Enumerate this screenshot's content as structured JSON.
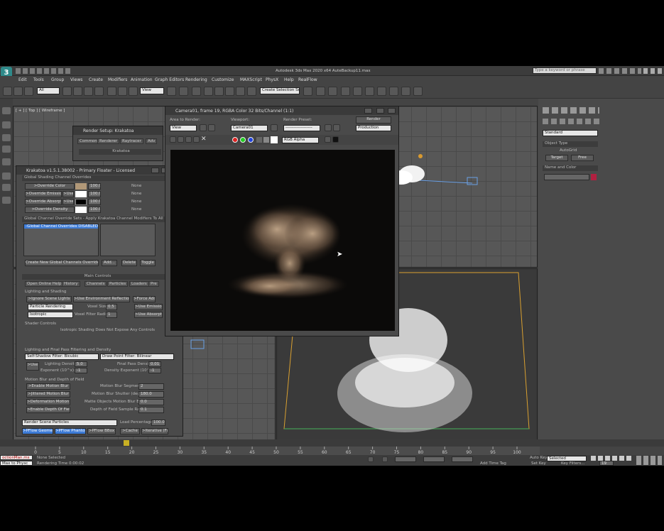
{
  "app": {
    "title": "Autodesk 3ds Max 2020 x64    AuteBackup11.max",
    "search_placeholder": "Type a keyword or phrase",
    "menu": [
      "Edit",
      "Tools",
      "Group",
      "Views",
      "Create",
      "Modifiers",
      "Animation",
      "Graph Editors",
      "Rendering",
      "Customize",
      "MAXScript",
      "PhysX",
      "Help",
      "RealFlow"
    ],
    "selection_filter": "All",
    "view_dropdown": "View",
    "create_selection": "Create Selection Se"
  },
  "viewport_top": {
    "label": "[ + ] [ Top ] [ Wireframe ]"
  },
  "render_setup": {
    "title": "Render Setup: Krakatoa",
    "tabs": [
      "Common",
      "Renderer",
      "Raytracer",
      "Adv"
    ],
    "section": "Krakatoa"
  },
  "frame_window": {
    "title": "Camera01, frame 19, RGBA Color 32 Bits/Channel (1:1)",
    "area_label": "Area to Render:",
    "area_value": "View",
    "viewport_label": "Viewport:",
    "viewport_value": "Camera01",
    "preset_label": "Render Preset:",
    "preset_value": "-------------------",
    "render_button": "Render",
    "production_value": "Production",
    "channel_value": "RGB Alpha"
  },
  "krakatoa": {
    "title": "Krakatoa v1.5.1.38002 - Primary Floater - Licensed",
    "overrides_header": "Global Shading Channel Overrides",
    "override_rows": [
      {
        "button": ">Override Color",
        "value": "100.0",
        "status": "None"
      },
      {
        "button": ">Override Emission",
        "use": ">Use",
        "value": "100.0",
        "status": "None"
      },
      {
        "button": ">Override Absorption",
        "use": ">Use",
        "value": "100.0",
        "status": "None"
      },
      {
        "button": ">Override Density",
        "value": "100.0",
        "status": "None"
      }
    ],
    "override_sets_header": "Global Channel Override Sets - Apply Krakatoa Channel Modifiers To All Particl",
    "override_list_item": "-Global Channel Overrides DISABLED-",
    "set_buttons": [
      "Create New Global Channels Override Set",
      "Add...",
      "Delete",
      "Toggle"
    ],
    "main_controls": "Main Controls",
    "main_tabs": [
      "Open Online Help...",
      "History",
      "Channels",
      "Particles",
      "Loaders",
      "Pre"
    ],
    "lighting_header": "Lighting and Shading",
    "lighting_buttons": [
      ">Ignore Scene Lights",
      ">Use Environment Reflections",
      ">Force Add"
    ],
    "render_mode": "Particle Rendering",
    "voxel_size_label": "Voxel Size",
    "voxel_size": "0.5",
    "use_emission": ">Use Emission",
    "shader": "Isotropic",
    "voxel_filter_label": "Voxel Filter Radius",
    "voxel_filter": "1",
    "use_absorption": ">Use Absorption",
    "shader_controls": "Shader Controls",
    "shader_note": "Isotropic Shading Does Not Expose Any Controls",
    "filtering_header": "Lighting and Final Pass Filtering and Density",
    "self_shadow_filter": "Self-Shadow Filter: Bicubic",
    "draw_point_filter": "Draw Point Filter: Bilinear",
    "use_btn": ">Use",
    "lighting_density_label": "Lighting Density:",
    "lighting_density": "5.0",
    "exponent_label": "Exponent (10^x):",
    "exponent": "-1",
    "final_pass_label": "Final Pass Density:",
    "final_pass": "0.01",
    "density_exp_label": "Density Exponent (10^x):",
    "density_exp": "-1",
    "motion_header": "Motion Blur and Depth of Field",
    "motion_buttons": [
      ">Enable Motion Blur",
      ">Jittered Motion Blur",
      ">Deformation Motion Blur",
      ">Enable Depth Of Field"
    ],
    "motion_labels": [
      "Motion Blur Segments:",
      "Motion Blur Shutter (degs):",
      "Matte Objects Motion Blur Bias:",
      "Depth of Field Sample Rate:"
    ],
    "motion_values": [
      "2",
      "180.0",
      "0.0",
      "0.1"
    ],
    "render_scene": "Render Scene Particles",
    "load_percentage_label": "Load Percentage:",
    "load_percentage": "100.0",
    "bottom_buttons": [
      ">PFlow Geometry",
      ">PFlow Phantom",
      ">PFlow BBox",
      ">Iterative (Full)"
    ],
    "cache_label": ">Cache"
  },
  "command_panel": {
    "dropdown": "Standard",
    "object_type": "Object Type",
    "autogrid": "AutoGrid",
    "target": "Target",
    "free": "Free",
    "name_color": "Name and Color",
    "swatch_color": "#b02040"
  },
  "timeline": {
    "ticks": [
      "0",
      "5",
      "10",
      "15",
      "20",
      "25",
      "30",
      "35",
      "40",
      "45",
      "50",
      "55",
      "60",
      "65",
      "70",
      "75",
      "80",
      "85",
      "90",
      "95",
      "100"
    ],
    "current": "19"
  },
  "status": {
    "maxscript": "octionMan.ms",
    "listener": "Max to Physc",
    "selection": "None Selected",
    "rendering_time": "Rendering Time  0:00:02",
    "add_time_tag": "Add Time Tag",
    "auto_key": "Auto Key",
    "set_key": "Set Key",
    "key_filters": "Key Filters...",
    "selected": "Selected",
    "frame": "19"
  },
  "colors": {
    "accent_blue": "#5a8fd8",
    "swatch_tan": "#b19878"
  }
}
